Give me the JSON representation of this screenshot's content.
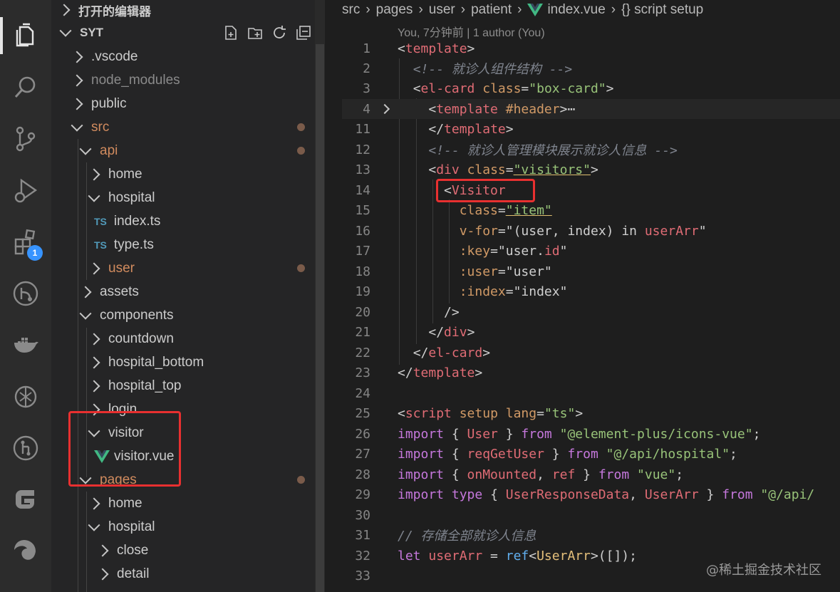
{
  "activity_bar": {
    "icons": [
      "explorer-icon",
      "search-icon",
      "source-control-icon",
      "run-debug-icon",
      "extensions-icon",
      "git-graph-icon",
      "docker-icon",
      "chatgpt-icon",
      "github-icon",
      "gitee-icon",
      "edge-icon"
    ],
    "extensions_badge": "1"
  },
  "sidebar": {
    "open_editors_label": "打开的编辑器",
    "project_label": "SYT",
    "tree": [
      {
        "label": ".vscode",
        "state": "collapsed"
      },
      {
        "label": "node_modules",
        "state": "collapsed",
        "dim": true
      },
      {
        "label": "public",
        "state": "collapsed"
      },
      {
        "label": "src",
        "state": "expanded",
        "modified": true
      },
      {
        "label": "api",
        "state": "expanded",
        "modified": true
      },
      {
        "label": "home",
        "state": "collapsed"
      },
      {
        "label": "hospital",
        "state": "expanded"
      },
      {
        "label": "index.ts",
        "type": "TS"
      },
      {
        "label": "type.ts",
        "type": "TS"
      },
      {
        "label": "user",
        "state": "collapsed",
        "modified": true
      },
      {
        "label": "assets",
        "state": "collapsed"
      },
      {
        "label": "components",
        "state": "expanded"
      },
      {
        "label": "countdown",
        "state": "collapsed"
      },
      {
        "label": "hospital_bottom",
        "state": "collapsed"
      },
      {
        "label": "hospital_top",
        "state": "collapsed"
      },
      {
        "label": "login",
        "state": "collapsed"
      },
      {
        "label": "visitor",
        "state": "expanded"
      },
      {
        "label": "visitor.vue",
        "type": "vue"
      },
      {
        "label": "pages",
        "state": "expanded",
        "modified": true
      },
      {
        "label": "home",
        "state": "collapsed"
      },
      {
        "label": "hospital",
        "state": "expanded"
      },
      {
        "label": "close",
        "state": "collapsed"
      },
      {
        "label": "detail",
        "state": "collapsed"
      }
    ],
    "ts_badge": "TS"
  },
  "editor": {
    "breadcrumb": [
      "src",
      "pages",
      "user",
      "patient",
      "index.vue",
      "{} script setup"
    ],
    "blame": "You, 7分钟前 | 1 author (You)",
    "line_numbers": [
      "1",
      "2",
      "3",
      "4",
      "11",
      "12",
      "13",
      "14",
      "15",
      "16",
      "17",
      "18",
      "19",
      "20",
      "21",
      "22",
      "23",
      "24",
      "25",
      "26",
      "27",
      "28",
      "29",
      "30",
      "31",
      "32",
      "33"
    ]
  },
  "code": {
    "l1": [
      "<",
      "template",
      ">"
    ],
    "l2": "<!-- 就诊人组件结构 -->",
    "l3": [
      "<",
      "el-card",
      "class",
      "=",
      "\"box-card\"",
      ">"
    ],
    "l4": [
      "<",
      "template",
      "#header",
      ">",
      "⋯"
    ],
    "l11": [
      "</",
      "template",
      ">"
    ],
    "l12": "<!-- 就诊人管理模块展示就诊人信息 -->",
    "l13": [
      "<",
      "div",
      "class",
      "=",
      "\"visitors\"",
      ">"
    ],
    "l14": [
      "<",
      "Visitor"
    ],
    "l15": [
      "class",
      "=",
      "\"item\""
    ],
    "l16": [
      "v-for",
      "=",
      "\"(",
      "user",
      ", ",
      "index",
      ") in ",
      "userArr",
      "\""
    ],
    "l17": [
      ":key",
      "=",
      "\"",
      "user",
      ".",
      "id",
      "\""
    ],
    "l18": [
      ":user",
      "=",
      "\"user\""
    ],
    "l19": [
      ":index",
      "=",
      "\"index\""
    ],
    "l20": "/>",
    "l21": [
      "</",
      "div",
      ">"
    ],
    "l22": [
      "</",
      "el-card",
      ">"
    ],
    "l23": [
      "</",
      "template",
      ">"
    ],
    "l25": [
      "<",
      "script",
      "setup",
      "lang",
      "=",
      "\"ts\"",
      ">"
    ],
    "l26": [
      "import",
      " { ",
      "User",
      " } ",
      "from",
      " ",
      "\"@element-plus/icons-vue\"",
      ";"
    ],
    "l27": [
      "import",
      " { ",
      "reqGetUser",
      " } ",
      "from",
      " ",
      "\"@/api/hospital\"",
      ";"
    ],
    "l28": [
      "import",
      " { ",
      "onMounted",
      ", ",
      "ref",
      " } ",
      "from",
      " ",
      "\"vue\"",
      ";"
    ],
    "l29": [
      "import",
      " ",
      "type",
      " { ",
      "UserResponseData",
      ", ",
      "UserArr",
      " } ",
      "from",
      " ",
      "\"@/api/"
    ],
    "l31": "// 存储全部就诊人信息",
    "l32": [
      "let",
      " ",
      "userArr",
      " = ",
      "ref",
      "<",
      "UserArr",
      ">([]);"
    ]
  },
  "watermark": "@稀土掘金技术社区"
}
